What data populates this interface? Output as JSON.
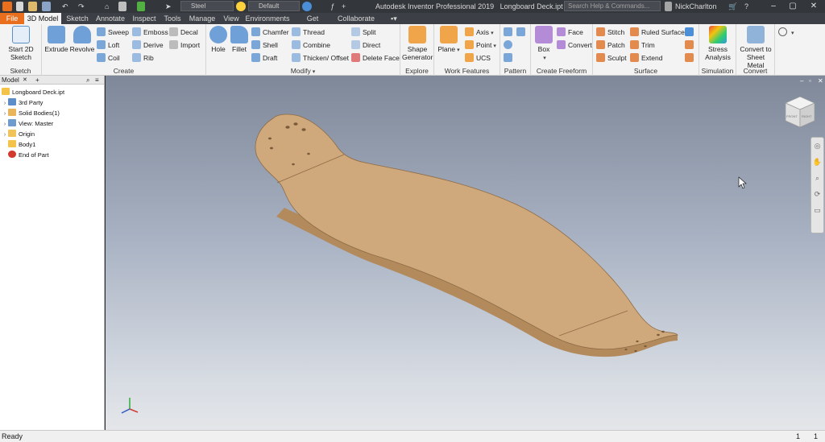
{
  "window": {
    "title": "Autodesk Inventor Professional 2019",
    "document": "Longboard Deck.ipt",
    "search_placeholder": "Search Help & Commands...",
    "user": "NickCharlton"
  },
  "quick_access": {
    "material": "Steel",
    "appearance": "Default"
  },
  "tabs": [
    {
      "label": "File"
    },
    {
      "label": "3D Model"
    },
    {
      "label": "Sketch"
    },
    {
      "label": "Annotate"
    },
    {
      "label": "Inspect"
    },
    {
      "label": "Tools"
    },
    {
      "label": "Manage"
    },
    {
      "label": "View"
    },
    {
      "label": "Environments"
    },
    {
      "label": "Get Started"
    },
    {
      "label": "Collaborate"
    }
  ],
  "ribbon": {
    "sketch": {
      "label": "Sketch",
      "start": "Start 2D Sketch"
    },
    "create": {
      "label": "Create",
      "extrude": "Extrude",
      "revolve": "Revolve",
      "sweep": "Sweep",
      "emboss": "Emboss",
      "decal": "Decal",
      "loft": "Loft",
      "derive": "Derive",
      "import": "Import",
      "coil": "Coil",
      "rib": "Rib"
    },
    "modify": {
      "label": "Modify",
      "hole": "Hole",
      "fillet": "Fillet",
      "chamfer": "Chamfer",
      "thread": "Thread",
      "split": "Split",
      "shell": "Shell",
      "combine": "Combine",
      "direct": "Direct",
      "draft": "Draft",
      "thicken": "Thicken/ Offset",
      "delete_face": "Delete Face"
    },
    "explore": {
      "label": "Explore",
      "shape_generator": "Shape Generator"
    },
    "work_features": {
      "label": "Work Features",
      "plane": "Plane",
      "axis": "Axis",
      "point": "Point",
      "ucs": "UCS"
    },
    "pattern": {
      "label": "Pattern"
    },
    "freeform": {
      "label": "Create Freeform",
      "box": "Box",
      "face": "Face",
      "convert": "Convert"
    },
    "surface": {
      "label": "Surface",
      "stitch": "Stitch",
      "ruled": "Ruled Surface",
      "patch": "Patch",
      "trim": "Trim",
      "sculpt": "Sculpt",
      "extend": "Extend"
    },
    "simulation": {
      "label": "Simulation",
      "stress": "Stress Analysis"
    },
    "convert": {
      "label": "Convert",
      "sheet_metal": "Convert to Sheet Metal"
    }
  },
  "browser": {
    "tab": "Model",
    "nodes": [
      {
        "label": "Longboard Deck.ipt"
      },
      {
        "label": "3rd Party"
      },
      {
        "label": "Solid Bodies(1)"
      },
      {
        "label": "View: Master"
      },
      {
        "label": "Origin"
      },
      {
        "label": "Body1"
      },
      {
        "label": "End of Part"
      }
    ]
  },
  "viewcube": {
    "face_front": "FRONT",
    "face_right": "RIGHT"
  },
  "status": {
    "text": "Ready",
    "count1": "1",
    "count2": "1"
  },
  "colors": {
    "accent": "#e96f1f",
    "deck": "#cfa97c",
    "deck_edge": "#b38a5c"
  }
}
